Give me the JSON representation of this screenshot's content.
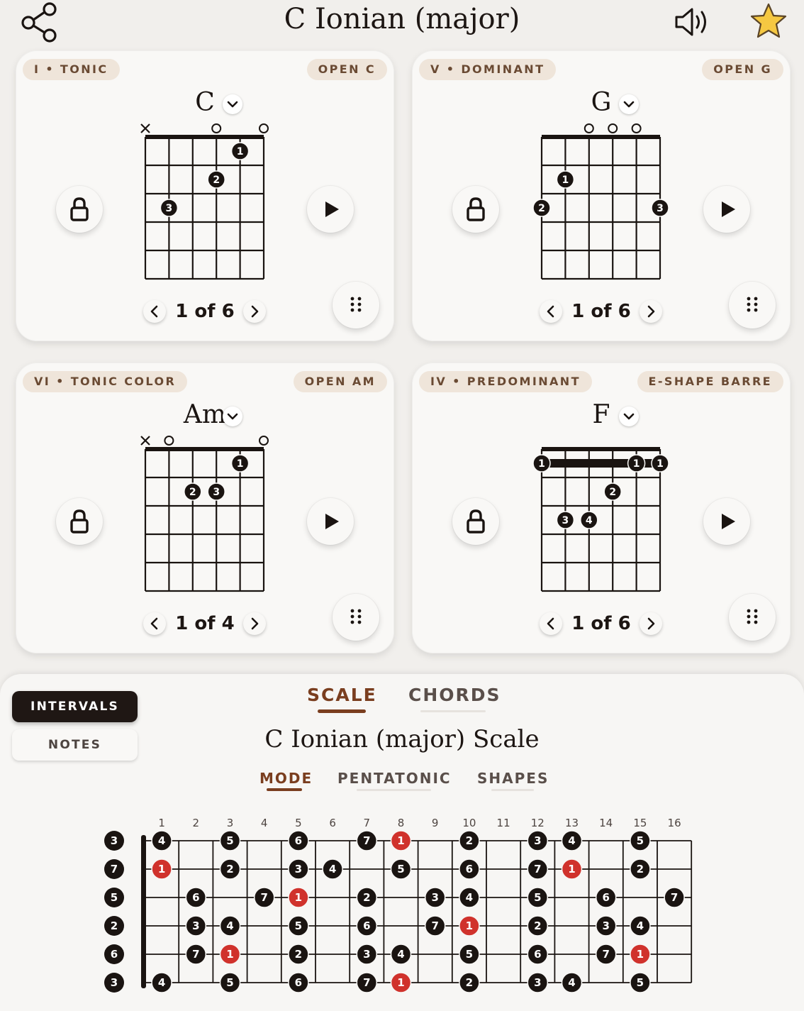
{
  "header": {
    "title": "C Ionian (major)",
    "icons": [
      "share-icon",
      "speaker-icon",
      "star-icon"
    ]
  },
  "colors": {
    "accent": "#7a3e1f",
    "pill_bg": "#efe5da",
    "pill_text": "#6a4a33",
    "root_dot": "#d0322c",
    "dot": "#1a1411",
    "star": "#f5c842"
  },
  "cards": [
    {
      "role": "I • TONIC",
      "voicing": "OPEN C",
      "chord": "C",
      "nav": "1 of 6",
      "barre": null,
      "markers": [
        "x",
        "",
        "",
        "o",
        "",
        "o"
      ],
      "dots": [
        {
          "string": 5,
          "fret": 1,
          "finger": "1"
        },
        {
          "string": 4,
          "fret": 2,
          "finger": "2"
        },
        {
          "string": 2,
          "fret": 3,
          "finger": "3"
        }
      ]
    },
    {
      "role": "V • DOMINANT",
      "voicing": "OPEN G",
      "chord": "G",
      "nav": "1 of 6",
      "barre": null,
      "markers": [
        "",
        "",
        "o",
        "o",
        "o",
        ""
      ],
      "dots": [
        {
          "string": 2,
          "fret": 2,
          "finger": "1"
        },
        {
          "string": 1,
          "fret": 3,
          "finger": "2"
        },
        {
          "string": 6,
          "fret": 3,
          "finger": "3"
        }
      ]
    },
    {
      "role": "VI • TONIC COLOR",
      "voicing": "OPEN AM",
      "chord": "Am",
      "nav": "1 of 4",
      "barre": null,
      "markers": [
        "x",
        "o",
        "",
        "",
        "",
        "o"
      ],
      "dots": [
        {
          "string": 5,
          "fret": 1,
          "finger": "1"
        },
        {
          "string": 3,
          "fret": 2,
          "finger": "2"
        },
        {
          "string": 4,
          "fret": 2,
          "finger": "3"
        }
      ]
    },
    {
      "role": "IV • PREDOMINANT",
      "voicing": "E-SHAPE BARRE",
      "chord": "F",
      "nav": "1 of 6",
      "barre": {
        "fret": 1,
        "finger": "1"
      },
      "markers": [
        "",
        "",
        "",
        "",
        "",
        ""
      ],
      "dots": [
        {
          "string": 1,
          "fret": 1,
          "finger": "1"
        },
        {
          "string": 5,
          "fret": 1,
          "finger": "1"
        },
        {
          "string": 6,
          "fret": 1,
          "finger": "1"
        },
        {
          "string": 4,
          "fret": 2,
          "finger": "2"
        },
        {
          "string": 2,
          "fret": 3,
          "finger": "3"
        },
        {
          "string": 3,
          "fret": 3,
          "finger": "4"
        }
      ]
    }
  ],
  "bottom": {
    "toggles": {
      "active": "INTERVALS",
      "inactive": "NOTES"
    },
    "tabs": {
      "scale": "SCALE",
      "chords": "CHORDS"
    },
    "scale_title": "C Ionian (major) Scale",
    "subtabs": {
      "mode": "MODE",
      "pentatonic": "PENTATONIC",
      "shapes": "SHAPES"
    },
    "fret_numbers": [
      "1",
      "2",
      "3",
      "4",
      "5",
      "6",
      "7",
      "8",
      "9",
      "10",
      "11",
      "12",
      "13",
      "14",
      "15",
      "16"
    ],
    "open_strings": [
      "3",
      "7",
      "5",
      "2",
      "6",
      "3"
    ],
    "fretboard": [
      [
        [
          "1",
          "4"
        ],
        [
          "3",
          "5"
        ],
        [
          "5",
          "6"
        ],
        [
          "7",
          "7"
        ],
        [
          "8",
          "1"
        ],
        [
          "10",
          "2"
        ],
        [
          "12",
          "3"
        ],
        [
          "13",
          "4"
        ],
        [
          "15",
          "5"
        ]
      ],
      [
        [
          "1",
          "1"
        ],
        [
          "3",
          "2"
        ],
        [
          "5",
          "3"
        ],
        [
          "6",
          "4"
        ],
        [
          "8",
          "5"
        ],
        [
          "10",
          "6"
        ],
        [
          "12",
          "7"
        ],
        [
          "13",
          "1"
        ],
        [
          "15",
          "2"
        ]
      ],
      [
        [
          "2",
          "6"
        ],
        [
          "4",
          "7"
        ],
        [
          "5",
          "1"
        ],
        [
          "7",
          "2"
        ],
        [
          "9",
          "3"
        ],
        [
          "10",
          "4"
        ],
        [
          "12",
          "5"
        ],
        [
          "14",
          "6"
        ],
        [
          "16",
          "7"
        ]
      ],
      [
        [
          "2",
          "3"
        ],
        [
          "3",
          "4"
        ],
        [
          "5",
          "5"
        ],
        [
          "7",
          "6"
        ],
        [
          "9",
          "7"
        ],
        [
          "10",
          "1"
        ],
        [
          "12",
          "2"
        ],
        [
          "14",
          "3"
        ],
        [
          "15",
          "4"
        ]
      ],
      [
        [
          "2",
          "7"
        ],
        [
          "3",
          "1"
        ],
        [
          "5",
          "2"
        ],
        [
          "7",
          "3"
        ],
        [
          "8",
          "4"
        ],
        [
          "10",
          "5"
        ],
        [
          "12",
          "6"
        ],
        [
          "14",
          "7"
        ],
        [
          "15",
          "1"
        ]
      ],
      [
        [
          "1",
          "4"
        ],
        [
          "3",
          "5"
        ],
        [
          "5",
          "6"
        ],
        [
          "7",
          "7"
        ],
        [
          "8",
          "1"
        ],
        [
          "10",
          "2"
        ],
        [
          "12",
          "3"
        ],
        [
          "13",
          "4"
        ],
        [
          "15",
          "5"
        ]
      ]
    ]
  }
}
